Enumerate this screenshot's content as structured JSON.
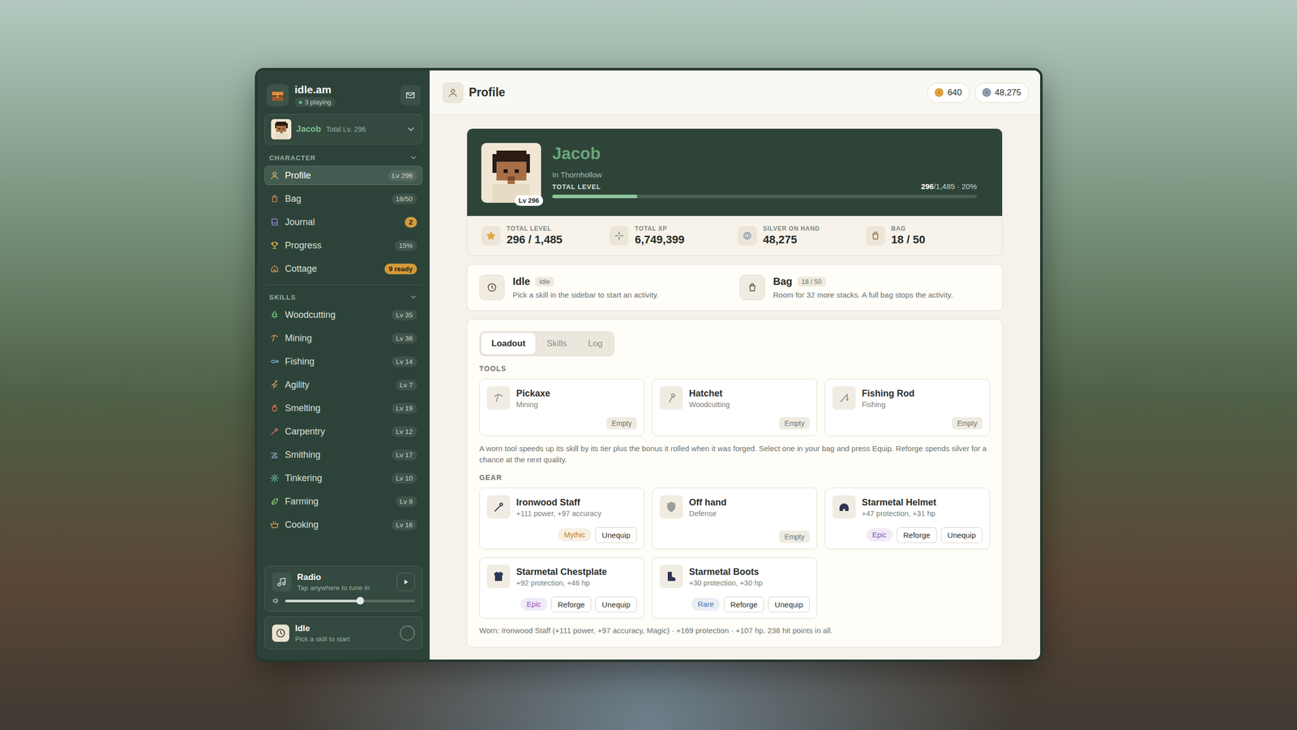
{
  "app": {
    "name": "idle.am",
    "players": "3 playing"
  },
  "character": {
    "name": "Jacob",
    "total": "Total Lv. 296"
  },
  "sidebar": {
    "sections": [
      {
        "title": "CHARACTER",
        "expanded": true,
        "items": [
          {
            "label": "Profile",
            "badge": "Lv 296",
            "highlight": false,
            "selected": true
          },
          {
            "label": "Bag",
            "badge": "18/50",
            "highlight": false,
            "selected": false
          },
          {
            "label": "Journal",
            "badge": "2",
            "highlight": true,
            "selected": false
          },
          {
            "label": "Progress",
            "badge": "15%",
            "highlight": false,
            "selected": false
          },
          {
            "label": "Cottage",
            "badge": "9 ready",
            "highlight": true,
            "selected": false
          }
        ]
      },
      {
        "title": "SKILLS",
        "expanded": true,
        "items": [
          {
            "label": "Woodcutting",
            "badge": "Lv 35",
            "highlight": false,
            "selected": false
          },
          {
            "label": "Mining",
            "badge": "Lv 36",
            "highlight": false,
            "selected": false
          },
          {
            "label": "Fishing",
            "badge": "Lv 14",
            "highlight": false,
            "selected": false
          },
          {
            "label": "Agility",
            "badge": "Lv 7",
            "highlight": false,
            "selected": false
          },
          {
            "label": "Smelting",
            "badge": "Lv 19",
            "highlight": false,
            "selected": false
          },
          {
            "label": "Carpentry",
            "badge": "Lv 12",
            "highlight": false,
            "selected": false
          },
          {
            "label": "Smithing",
            "badge": "Lv 17",
            "highlight": false,
            "selected": false
          },
          {
            "label": "Tinkering",
            "badge": "Lv 10",
            "highlight": false,
            "selected": false
          },
          {
            "label": "Farming",
            "badge": "Lv 9",
            "highlight": false,
            "selected": false
          },
          {
            "label": "Cooking",
            "badge": "Lv 16",
            "highlight": false,
            "selected": false
          }
        ]
      }
    ]
  },
  "radio": {
    "title": "Radio",
    "hint": "Tap anywhere to tune in",
    "level": 0.58,
    "playing": false
  },
  "activity": {
    "title": "Idle",
    "hint": "Pick a skill to start",
    "running": false
  },
  "header": {
    "title": "Profile",
    "currencies": [
      {
        "value": "640",
        "color": "#d9952b"
      },
      {
        "value": "48,275",
        "color": "#7d8ea3"
      }
    ]
  },
  "hero": {
    "name": "Jacob",
    "location": "In Thornhollow",
    "badge": "Lv 296",
    "bar_label": "TOTAL LEVEL",
    "reading_value": "296",
    "reading_rest": "/1,485 · 20%",
    "level": 0.2
  },
  "stats": [
    {
      "label": "TOTAL LEVEL",
      "value": "296 / 1,485"
    },
    {
      "label": "TOTAL XP",
      "value": "6,749,399"
    },
    {
      "label": "SILVER ON HAND",
      "value": "48,275"
    },
    {
      "label": "BAG",
      "value": "18 / 50"
    }
  ],
  "status": [
    {
      "title": "Idle",
      "tag": "Idle",
      "text": "Pick a skill in the sidebar to start an activity."
    },
    {
      "title": "Bag",
      "tag": "18 / 50",
      "text": "Room for 32 more stacks. A full bag stops the activity."
    }
  ],
  "tabs": [
    {
      "label": "Loadout",
      "selected": true
    },
    {
      "label": "Skills",
      "selected": false
    },
    {
      "label": "Log",
      "selected": false
    }
  ],
  "tools": {
    "title": "TOOLS",
    "items": [
      {
        "name": "Pickaxe",
        "skill": "Mining",
        "state": "Empty"
      },
      {
        "name": "Hatchet",
        "skill": "Woodcutting",
        "state": "Empty"
      },
      {
        "name": "Fishing Rod",
        "skill": "Fishing",
        "state": "Empty"
      }
    ],
    "note": "A worn tool speeds up its skill by its tier plus the bonus it rolled when it was forged. Select one in your bag and press Equip. Reforge spends silver for a chance at the next quality."
  },
  "gear": {
    "title": "GEAR",
    "items": [
      {
        "kind": "equipped",
        "name": "Ironwood Staff",
        "stats": "+111 power, +97 accuracy",
        "rarity": "Mythic",
        "color": "#b9822c",
        "actions": [
          "Unequip"
        ]
      },
      {
        "kind": "empty",
        "name": "Off hand",
        "stats": "Defense",
        "state": "Empty"
      },
      {
        "kind": "equipped",
        "name": "Starmetal Helmet",
        "stats": "+47 protection, +31 hp",
        "rarity": "Epic",
        "color": "#8e58b8",
        "actions": [
          "Reforge",
          "Unequip"
        ]
      },
      {
        "kind": "equipped",
        "name": "Starmetal Chestplate",
        "stats": "+92 protection, +46 hp",
        "rarity": "Epic",
        "color": "#8e58b8",
        "actions": [
          "Reforge",
          "Unequip"
        ]
      },
      {
        "kind": "equipped",
        "name": "Starmetal Boots",
        "stats": "+30 protection, +30 hp",
        "rarity": "Rare",
        "color": "#4a74ad",
        "actions": [
          "Reforge",
          "Unequip"
        ]
      }
    ],
    "note": "Worn: Ironwood Staff (+111 power, +97 accuracy, Magic) · +169 protection · +107 hp. 238 hit points in all."
  }
}
